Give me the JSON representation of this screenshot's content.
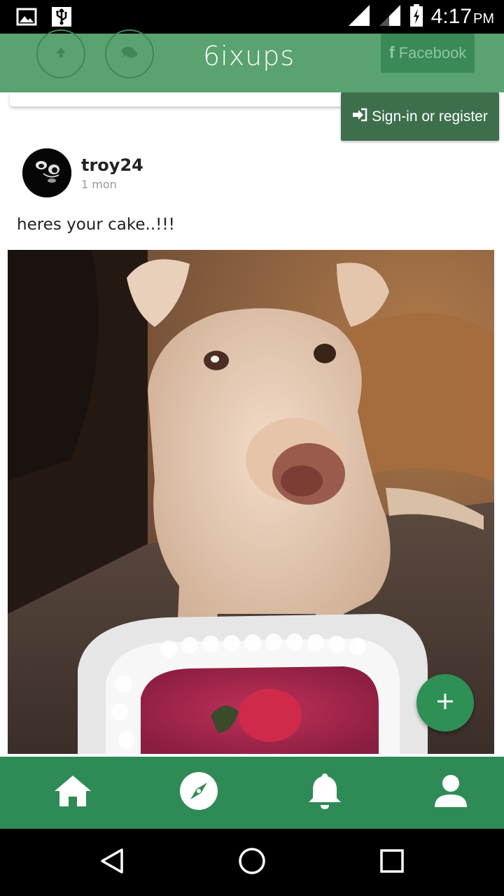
{
  "status_bar": {
    "time": "4:17",
    "ampm": "PM",
    "icons": [
      "image-icon",
      "usb-icon",
      "signal-icon",
      "signal-icon",
      "battery-charging-icon"
    ]
  },
  "header": {
    "logo": "6ixups",
    "facebook_label": "Facebook",
    "upvote_icon": "arrow-up-icon",
    "comments_icon": "chat-icon"
  },
  "signin": {
    "label": "Sign-in or register",
    "icon": "sign-in-icon"
  },
  "post": {
    "username": "troy24",
    "time_ago": "1 mon",
    "caption": "heres your cake..!!!"
  },
  "fab": {
    "icon": "plus-icon"
  },
  "bottom_nav": {
    "items": [
      "home-icon",
      "compass-icon",
      "bell-icon",
      "user-icon"
    ]
  },
  "system_nav": {
    "items": [
      "back-icon",
      "home-circle-icon",
      "recents-icon"
    ]
  },
  "colors": {
    "header": "#5aa26f",
    "nav": "#2e8b55",
    "signin": "#3d6f4d",
    "fab": "#2e9055"
  }
}
